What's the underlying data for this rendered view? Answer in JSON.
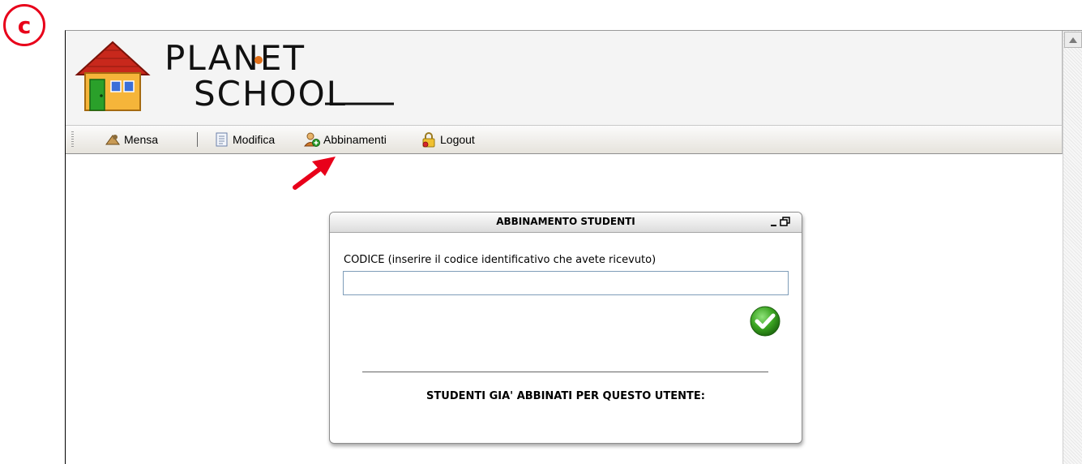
{
  "annotation": {
    "badge": "c"
  },
  "logo": {
    "line1": "PLANET",
    "line2": "SCHOOL"
  },
  "toolbar": {
    "items": [
      {
        "label": "Mensa",
        "icon": "mensa-icon"
      },
      {
        "label": "Modifica",
        "icon": "document-edit-icon"
      },
      {
        "label": "Abbinamenti",
        "icon": "user-add-icon"
      },
      {
        "label": "Logout",
        "icon": "lock-icon"
      }
    ]
  },
  "panel": {
    "title": "ABBINAMENTO STUDENTI",
    "code_label": "CODICE (inserire il codice identificativo che avete ricevuto)",
    "code_value": "",
    "linked_title": "STUDENTI GIA' ABBINATI PER QUESTO UTENTE:"
  },
  "colors": {
    "accent_red": "#e8001a",
    "confirm_green": "#3aa320"
  }
}
